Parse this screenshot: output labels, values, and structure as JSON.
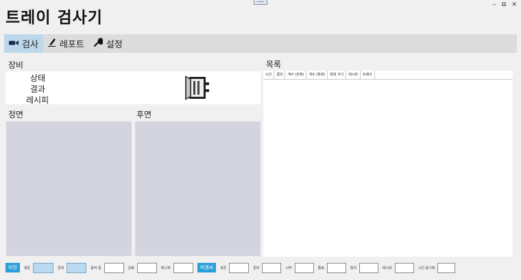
{
  "app": {
    "title": "트레이 검사기"
  },
  "window": {
    "minimize": "‒",
    "restore": "⧉",
    "close": "✕"
  },
  "tabs": [
    {
      "label": "검사",
      "icon": "camera-icon"
    },
    {
      "label": "레포트",
      "icon": "pencil-icon"
    },
    {
      "label": "설정",
      "icon": "wrench-icon"
    }
  ],
  "equipment": {
    "title": "장비",
    "status": "상태",
    "result": "결과",
    "recipe": "레시피",
    "icon": "cabinet-icon"
  },
  "views": {
    "front": "정면",
    "back": "후면"
  },
  "list": {
    "title": "목록",
    "columns": [
      "시간",
      "결과",
      "개수 (전체)",
      "개수 (최대)",
      "최대 크기",
      "레시피",
      "트레이"
    ]
  },
  "status": {
    "vision": {
      "label": "비전",
      "fields": [
        "생존",
        "준비",
        "동작 중",
        "완료",
        "레시피"
      ]
    },
    "pms": {
      "label": "피엠씨",
      "fields": [
        "생존",
        "준비",
        "시작",
        "종료",
        "정지",
        "레시피",
        "시간 동기화"
      ]
    }
  },
  "colors": {
    "accent": "#2a9fd8",
    "active_tab": "#bcd8ea",
    "image_placeholder": "#d3d4de"
  }
}
